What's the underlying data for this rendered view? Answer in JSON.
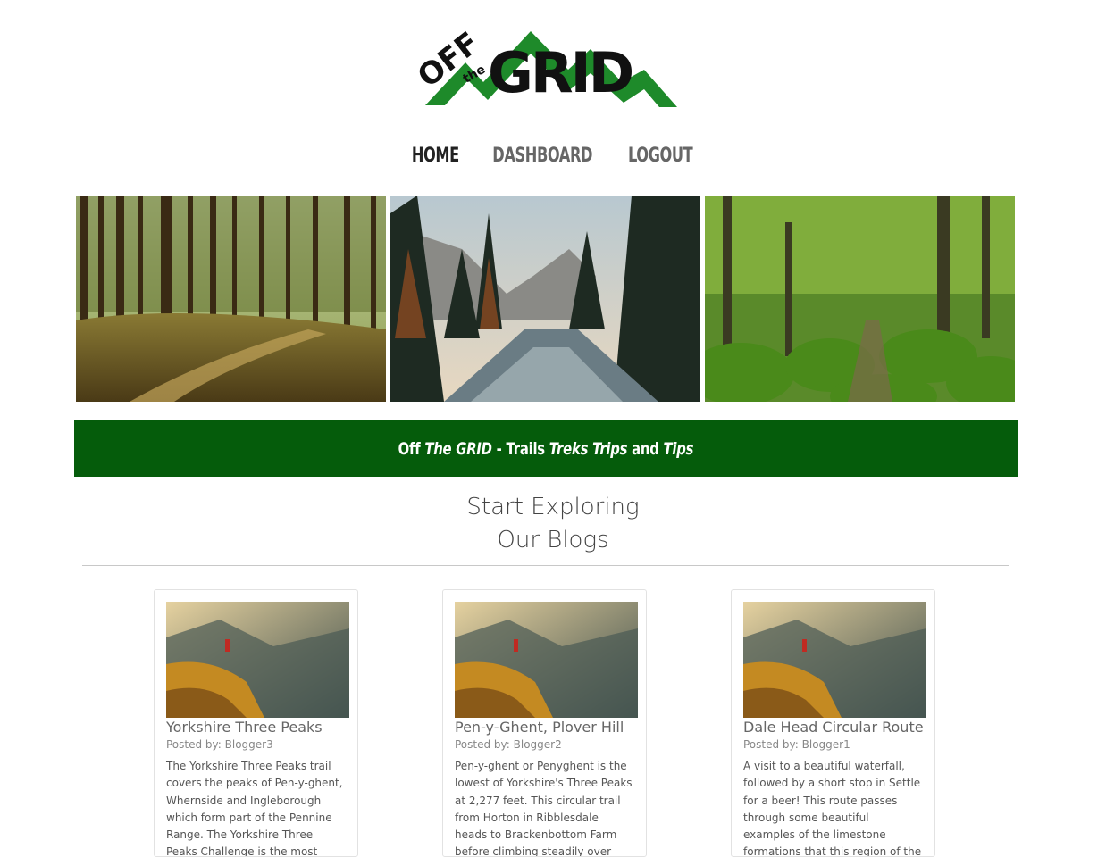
{
  "logo": {
    "brand": "Off the GRID"
  },
  "nav": {
    "items": [
      {
        "label": "HOME"
      },
      {
        "label": "DASHBOARD"
      },
      {
        "label": "LOGOUT"
      }
    ]
  },
  "banner": {
    "part1": "Off ",
    "part2": "The GRID",
    "part3": " - Trails ",
    "part4": "Treks",
    "part5": " Trips",
    "part6": " and ",
    "part7": "Tips"
  },
  "section": {
    "title_line1": "Start Exploring",
    "title_line2": "Our Blogs"
  },
  "cards": [
    {
      "title": "Yorkshire Three Peaks",
      "author": "Posted by: Blogger3",
      "body": "The Yorkshire Three Peaks trail covers the peaks of Pen-y-ghent, Whernside and Ingleborough which form part of the Pennine Range. The Yorkshire Three Peaks Challenge is the most iconic walk in"
    },
    {
      "title": "Pen-y-Ghent, Plover Hill",
      "author": "Posted by: Blogger2",
      "body": "Pen-y-ghent or Penyghent is the lowest of Yorkshire's Three Peaks at 2,277 feet. This circular trail from Horton in Ribblesdale heads to Brackenbottom Farm before climbing steadily over"
    },
    {
      "title": "Dale Head Circular Route",
      "author": "Posted by: Blogger1",
      "body": "A visit to a beautiful waterfall, followed by a short stop in Settle for a beer! This route passes through some beautiful examples of the limestone formations that this region of the nation is"
    }
  ],
  "colors": {
    "brand_green": "#055c0b",
    "logo_green": "#1e8a2a"
  }
}
